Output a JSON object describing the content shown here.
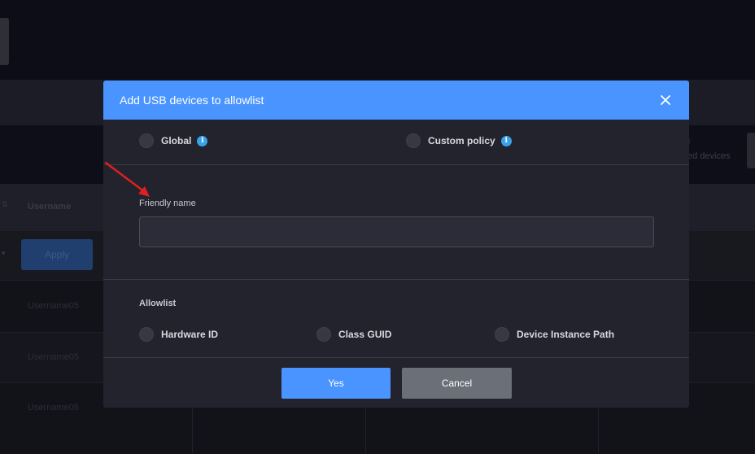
{
  "background": {
    "apply_label": "Apply",
    "column_header": "Username",
    "toolbar_text": "ed devices",
    "rows": [
      "Username05",
      "Username05",
      "Username05"
    ]
  },
  "dialog": {
    "title": "Add USB devices to allowlist",
    "scope_options": [
      {
        "label": "Global",
        "has_info": true
      },
      {
        "label": "Custom policy",
        "has_info": true
      }
    ],
    "info_glyph": "i",
    "friendly_name": {
      "label": "Friendly name",
      "value": "",
      "placeholder": ""
    },
    "allowlist": {
      "label": "Allowlist",
      "options": [
        "Hardware ID",
        "Class GUID",
        "Device Instance Path"
      ]
    },
    "buttons": {
      "yes": "Yes",
      "cancel": "Cancel"
    }
  },
  "colors": {
    "header": "#4a94ff",
    "primary_button": "#4a94ff",
    "secondary_button": "#6b6f78",
    "dialog_bg": "#23232e",
    "info_icon": "#3aa3e8",
    "annotation_arrow": "#e02020"
  },
  "icons": {
    "close": "close-icon",
    "info": "info-icon",
    "annotation": "red-arrow"
  }
}
